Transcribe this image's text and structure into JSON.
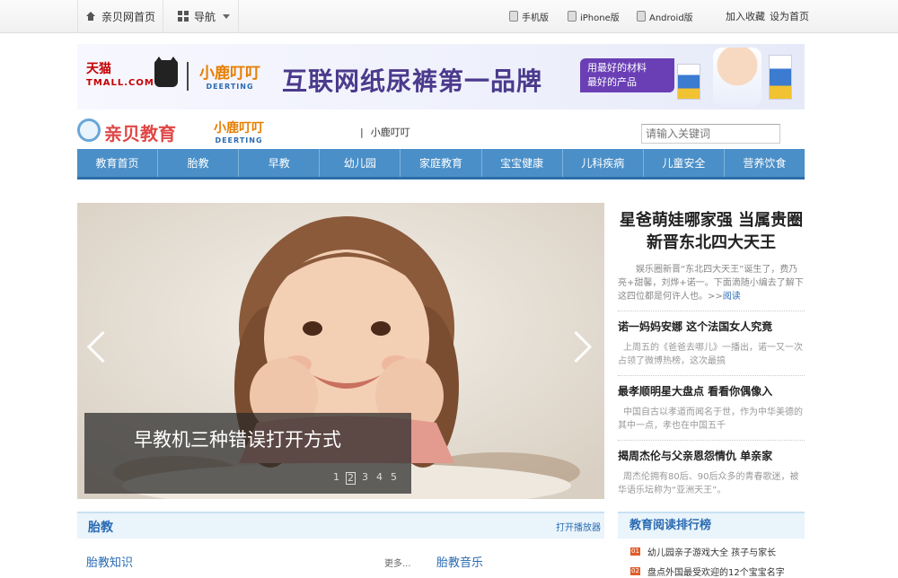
{
  "topbar": {
    "home_label": "亲贝网首页",
    "nav_label": "导航",
    "devices": [
      "手机版",
      "iPhone版",
      "Android版"
    ],
    "links": [
      "加入收藏",
      "设为首页"
    ]
  },
  "banner": {
    "tmall_cn": "天猫",
    "tmall_en": "TMALL.COM",
    "brand_cn": "小鹿叮叮",
    "brand_en": "DEERTING",
    "slogan": "互联网纸尿裤第一品牌",
    "tag_line1": "用最好的材料",
    "tag_line2": "最好的产品"
  },
  "header": {
    "logo_text": "亲贝教育",
    "brand_cn": "小鹿叮叮",
    "brand_en": "DEERTING",
    "breadcrumb": "小鹿叮叮",
    "search_placeholder": "请输入关键词"
  },
  "nav": [
    "教育首页",
    "胎教",
    "早教",
    "幼儿园",
    "家庭教育",
    "宝宝健康",
    "儿科疾病",
    "儿童安全",
    "营养饮食"
  ],
  "slider": {
    "caption": "早教机三种错误打开方式",
    "pages": [
      "1",
      "2",
      "3",
      "4",
      "5"
    ],
    "active_page": 2
  },
  "headline": {
    "title": "星爸萌娃哪家强 当属贵圈新晋东北四大天王",
    "lead": "娱乐圈新晋“东北四大天王”诞生了，费乃亮+甜馨，刘烨+诺一。下面滴随小编去了解下这四位都是何许人也。>>",
    "more": "阅读"
  },
  "news": [
    {
      "title": "诺一妈妈安娜 这个法国女人究竟",
      "summary": "上周五的《爸爸去哪儿》一播出，诺一又一次占领了微博热榜，这次最搞"
    },
    {
      "title": "最孝顺明星大盘点 看看你偶像入",
      "summary": "中国自古以孝道而闻名于世，作为中华美德的其中一点，孝也在中国五千"
    },
    {
      "title": "揭周杰伦与父亲恩怨情仇 单亲家",
      "summary": "周杰伦拥有80后、90后众多的青春歌迷，被华语乐坛称为“亚洲天王”。"
    }
  ],
  "section": {
    "title": "胎教",
    "link": "打开播放器",
    "sub1": "胎教知识",
    "more": "更多...",
    "sub2": "胎教音乐"
  },
  "ranking": {
    "title": "教育阅读排行榜",
    "items": [
      {
        "num": "01",
        "text": "幼儿园亲子游戏大全 孩子与家长"
      },
      {
        "num": "02",
        "text": "盘点外国最受欢迎的12个宝宝名字"
      }
    ]
  }
}
